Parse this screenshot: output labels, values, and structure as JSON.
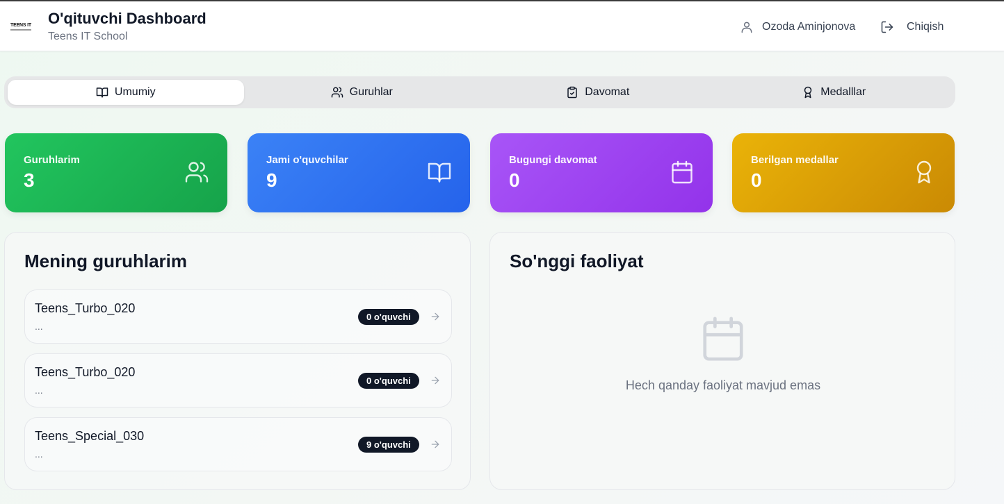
{
  "header": {
    "logo_text": "TEENS IT",
    "title": "O'qituvchi Dashboard",
    "subtitle": "Teens IT School",
    "user_name": "Ozoda Aminjonova",
    "logout_label": "Chiqish"
  },
  "tabs": [
    {
      "label": "Umumiy",
      "icon": "book-open-icon",
      "active": true
    },
    {
      "label": "Guruhlar",
      "icon": "users-icon",
      "active": false
    },
    {
      "label": "Davomat",
      "icon": "clipboard-check-icon",
      "active": false
    },
    {
      "label": "Medalllar",
      "icon": "award-icon",
      "active": false
    }
  ],
  "stats": [
    {
      "label": "Guruhlarim",
      "value": "3",
      "icon": "users-icon",
      "color": "#22c55e"
    },
    {
      "label": "Jami o'quvchilar",
      "value": "9",
      "icon": "book-open-icon",
      "color": "#3b82f6"
    },
    {
      "label": "Bugungi davomat",
      "value": "0",
      "icon": "calendar-icon",
      "color": "#a855f7"
    },
    {
      "label": "Berilgan medallar",
      "value": "0",
      "icon": "award-icon",
      "color": "#eab308"
    }
  ],
  "groups_panel": {
    "title": "Mening guruhlarim",
    "groups": [
      {
        "name": "Teens_Turbo_020",
        "desc": "...",
        "badge": "0 o'quvchi"
      },
      {
        "name": "Teens_Turbo_020",
        "desc": "...",
        "badge": "0 o'quvchi"
      },
      {
        "name": "Teens_Special_030",
        "desc": "...",
        "badge": "9 o'quvchi"
      }
    ]
  },
  "activity_panel": {
    "title": "So'nggi faoliyat",
    "empty_text": "Hech qanday faoliyat mavjud emas"
  }
}
